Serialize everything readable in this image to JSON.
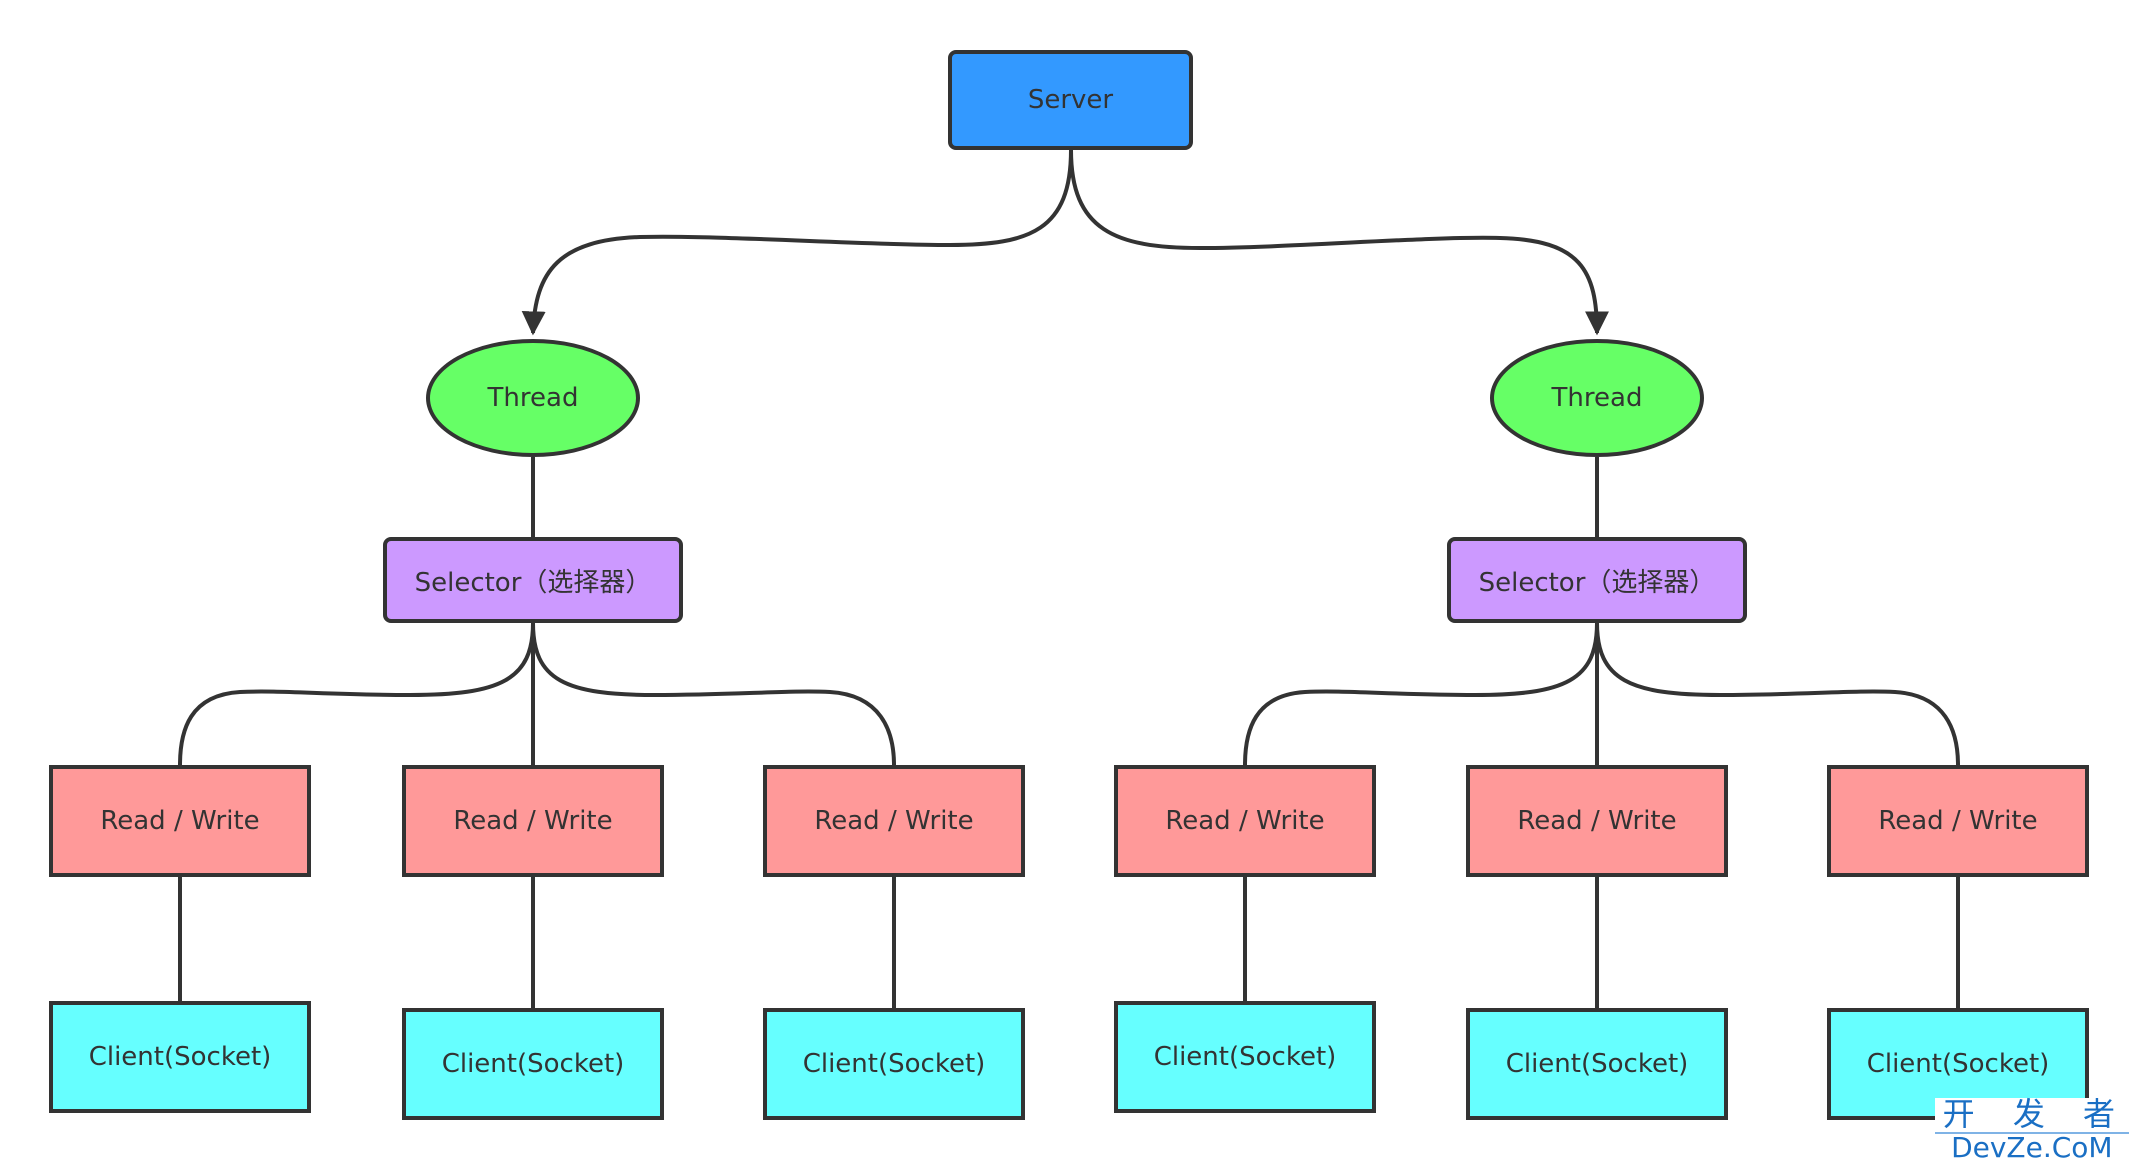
{
  "diagram": {
    "server": {
      "label": "Server",
      "color": "#3399ff"
    },
    "branches": [
      {
        "thread": {
          "label": "Thread",
          "color": "#66ff66"
        },
        "selector": {
          "label": "Selector（选择器）",
          "color": "#cc99ff"
        },
        "channels": [
          {
            "rw": "Read / Write",
            "client": "Client(Socket)"
          },
          {
            "rw": "Read / Write",
            "client": "Client(Socket)"
          },
          {
            "rw": "Read / Write",
            "client": "Client(Socket)"
          }
        ]
      },
      {
        "thread": {
          "label": "Thread",
          "color": "#66ff66"
        },
        "selector": {
          "label": "Selector（选择器）",
          "color": "#cc99ff"
        },
        "channels": [
          {
            "rw": "Read / Write",
            "client": "Client(Socket)"
          },
          {
            "rw": "Read / Write",
            "client": "Client(Socket)"
          },
          {
            "rw": "Read / Write",
            "client": "Client(Socket)"
          }
        ]
      }
    ],
    "colors": {
      "read_write": "#ff9999",
      "client": "#66ffff",
      "stroke": "#333333"
    }
  },
  "watermark": {
    "line1": "开 发 者",
    "line2": "DevZe.CoM"
  }
}
